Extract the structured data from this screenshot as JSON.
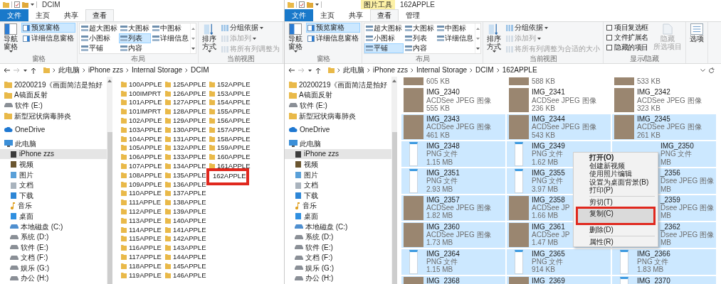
{
  "windows": [
    {
      "title_bar": {
        "title": "DCIM"
      },
      "tabs": [
        {
          "label": "文件",
          "kind": "file",
          "selected": false
        },
        {
          "label": "主页",
          "kind": "tab",
          "selected": false
        },
        {
          "label": "共享",
          "kind": "tab",
          "selected": false
        },
        {
          "label": "查看",
          "kind": "tab",
          "selected": true
        }
      ],
      "ribbon": {
        "groups": [
          {
            "kind": "panes",
            "label": "窗格",
            "large": {
              "label": "导航窗格",
              "dropdown": true
            },
            "buttons": [
              {
                "label": "预览窗格",
                "selected": true
              },
              {
                "label": "详细信息窗格",
                "selected": false
              }
            ]
          },
          {
            "kind": "layout",
            "label": "布局",
            "options": [
              {
                "label": "超大图标",
                "selected": false
              },
              {
                "label": "大图标",
                "selected": false
              },
              {
                "label": "中图标",
                "selected": false
              },
              {
                "label": "小图标",
                "selected": false
              },
              {
                "label": "列表",
                "selected": true
              },
              {
                "label": "详细信息",
                "selected": false
              },
              {
                "label": "平铺",
                "selected": false
              },
              {
                "label": "内容",
                "selected": false
              }
            ]
          },
          {
            "kind": "view",
            "label": "当前视图",
            "large": {
              "label": "排序方式",
              "dropdown": true
            },
            "commands": [
              {
                "label": "分组依据",
                "dropdown": true,
                "disabled": false
              },
              {
                "label": "添加列",
                "dropdown": true,
                "disabled": true
              },
              {
                "label": "将所有列调整为",
                "dropdown": false,
                "disabled": true
              }
            ]
          }
        ]
      },
      "address": {
        "segments": [
          "此电脑",
          "iPhone zzs",
          "Internal Storage",
          "DCIM"
        ]
      },
      "navigation": [
        {
          "label": "20200219《画面简洁是拍好",
          "kind": "folder",
          "selected": false
        },
        {
          "label": "A镜面反射",
          "kind": "folder",
          "selected": false
        },
        {
          "label": "软件 (E:)",
          "kind": "drive",
          "selected": false
        },
        {
          "label": "新型冠状病毒肺炎",
          "kind": "folder",
          "selected": false
        },
        {
          "label": "OneDrive",
          "kind": "cloud",
          "selected": false
        },
        {
          "label": "此电脑",
          "kind": "pc",
          "selected": false,
          "children": [
            {
              "label": "iPhone zzs",
              "kind": "phone",
              "selected": true
            },
            {
              "label": "视频",
              "kind": "video",
              "selected": false
            },
            {
              "label": "图片",
              "kind": "pictures",
              "selected": false
            },
            {
              "label": "文档",
              "kind": "documents",
              "selected": false
            },
            {
              "label": "下载",
              "kind": "downloads",
              "selected": false
            },
            {
              "label": "音乐",
              "kind": "music",
              "selected": false
            },
            {
              "label": "桌面",
              "kind": "desktop",
              "selected": false
            },
            {
              "label": "本地磁盘 (C:)",
              "kind": "system",
              "selected": false
            },
            {
              "label": "系统 (D:)",
              "kind": "drive",
              "selected": false
            },
            {
              "label": "软件 (E:)",
              "kind": "drive",
              "selected": false
            },
            {
              "label": "文档 (F:)",
              "kind": "drive",
              "selected": false
            },
            {
              "label": "娱乐 (G:)",
              "kind": "drive",
              "selected": false
            },
            {
              "label": "办公 (H:)",
              "kind": "drive",
              "selected": false
            }
          ]
        }
      ],
      "content": {
        "kind": "list",
        "folders": [
          {
            "name": "100APPLE",
            "annotated": false
          },
          {
            "name": "100IMPRT",
            "annotated": false
          },
          {
            "name": "101APPLE",
            "annotated": false
          },
          {
            "name": "101IMPRT",
            "annotated": false
          },
          {
            "name": "102APPLE",
            "annotated": false
          },
          {
            "name": "103APPLE",
            "annotated": false
          },
          {
            "name": "104APPLE",
            "annotated": false
          },
          {
            "name": "105APPLE",
            "annotated": false
          },
          {
            "name": "106APPLE",
            "annotated": false
          },
          {
            "name": "107APPLE",
            "annotated": false
          },
          {
            "name": "108APPLE",
            "annotated": false
          },
          {
            "name": "109APPLE",
            "annotated": false
          },
          {
            "name": "110APPLE",
            "annotated": false
          },
          {
            "name": "111APPLE",
            "annotated": false
          },
          {
            "name": "112APPLE",
            "annotated": false
          },
          {
            "name": "113APPLE",
            "annotated": false
          },
          {
            "name": "114APPLE",
            "annotated": false
          },
          {
            "name": "115APPLE",
            "annotated": false
          },
          {
            "name": "116APPLE",
            "annotated": false
          },
          {
            "name": "117APPLE",
            "annotated": false
          },
          {
            "name": "118APPLE",
            "annotated": false
          },
          {
            "name": "119APPLE",
            "annotated": false
          },
          {
            "name": "125APPLE",
            "annotated": false
          },
          {
            "name": "126APPLE",
            "annotated": false
          },
          {
            "name": "127APPLE",
            "annotated": false
          },
          {
            "name": "128APPLE",
            "annotated": false
          },
          {
            "name": "129APPLE",
            "annotated": false
          },
          {
            "name": "130APPLE",
            "annotated": false
          },
          {
            "name": "131APPLE",
            "annotated": false
          },
          {
            "name": "132APPLE",
            "annotated": false
          },
          {
            "name": "133APPLE",
            "annotated": false
          },
          {
            "name": "134APPLE",
            "annotated": false
          },
          {
            "name": "135APPLE",
            "annotated": false
          },
          {
            "name": "136APPLE",
            "annotated": false
          },
          {
            "name": "137APPLE",
            "annotated": false
          },
          {
            "name": "138APPLE",
            "annotated": false
          },
          {
            "name": "139APPLE",
            "annotated": false
          },
          {
            "name": "140APPLE",
            "annotated": false
          },
          {
            "name": "141APPLE",
            "annotated": false
          },
          {
            "name": "142APPLE",
            "annotated": false
          },
          {
            "name": "143APPLE",
            "annotated": false
          },
          {
            "name": "144APPLE",
            "annotated": false
          },
          {
            "name": "145APPLE",
            "annotated": false
          },
          {
            "name": "146APPLE",
            "annotated": false
          },
          {
            "name": "152APPLE",
            "annotated": false
          },
          {
            "name": "153APPLE",
            "annotated": false
          },
          {
            "name": "154APPLE",
            "annotated": false
          },
          {
            "name": "155APPLE",
            "annotated": false
          },
          {
            "name": "156APPLE",
            "annotated": false
          },
          {
            "name": "157APPLE",
            "annotated": false
          },
          {
            "name": "158APPLE",
            "annotated": false
          },
          {
            "name": "159APPLE",
            "annotated": false
          },
          {
            "name": "160APPLE",
            "annotated": false
          },
          {
            "name": "161APPLE",
            "annotated": false
          },
          {
            "name": "162APPLE",
            "annotated": true
          }
        ]
      }
    },
    {
      "title_bar": {
        "context_tab": "图片工具",
        "title": "162APPLE"
      },
      "tabs": [
        {
          "label": "文件",
          "kind": "file",
          "selected": false
        },
        {
          "label": "主页",
          "kind": "tab",
          "selected": false
        },
        {
          "label": "共享",
          "kind": "tab",
          "selected": false
        },
        {
          "label": "查看",
          "kind": "tab",
          "selected": true
        },
        {
          "label": "管理",
          "kind": "tab",
          "selected": false
        }
      ],
      "ribbon": {
        "groups": [
          {
            "kind": "panes",
            "label": "窗格",
            "large": {
              "label": "导航窗格",
              "dropdown": true
            },
            "buttons": [
              {
                "label": "预览窗格",
                "selected": true
              },
              {
                "label": "详细信息窗格",
                "selected": false
              }
            ]
          },
          {
            "kind": "layout",
            "label": "布局",
            "options": [
              {
                "label": "超大图标",
                "selected": false
              },
              {
                "label": "大图标",
                "selected": false
              },
              {
                "label": "中图标",
                "selected": false
              },
              {
                "label": "小图标",
                "selected": false
              },
              {
                "label": "列表",
                "selected": false
              },
              {
                "label": "详细信息",
                "selected": false
              },
              {
                "label": "平铺",
                "selected": true
              },
              {
                "label": "内容",
                "selected": false
              }
            ]
          },
          {
            "kind": "view",
            "label": "当前视图",
            "large": {
              "label": "排序方式",
              "dropdown": true
            },
            "commands": [
              {
                "label": "分组依据",
                "dropdown": true,
                "disabled": false
              },
              {
                "label": "添加列",
                "dropdown": true,
                "disabled": true
              },
              {
                "label": "将所有列调整为合适的大小",
                "dropdown": false,
                "disabled": true
              }
            ]
          },
          {
            "kind": "show",
            "label": "显示/隐藏",
            "checkboxes": [
              {
                "label": "项目复选框",
                "checked": false
              },
              {
                "label": "文件扩展名",
                "checked": false
              },
              {
                "label": "隐藏的项目",
                "checked": false
              }
            ],
            "large": {
              "lines": [
                "隐藏",
                "所选项目"
              ],
              "disabled": true
            }
          },
          {
            "kind": "options",
            "large": {
              "label": "选项"
            }
          }
        ]
      },
      "address": {
        "segments": [
          "此电脑",
          "iPhone zzs",
          "Internal Storage",
          "DCIM",
          "162APPLE"
        ]
      },
      "navigation": [
        {
          "label": "20200219《画面简洁是拍好",
          "kind": "folder",
          "selected": false
        },
        {
          "label": "A镜面反射",
          "kind": "folder",
          "selected": false
        },
        {
          "label": "软件 (E:)",
          "kind": "drive",
          "selected": false
        },
        {
          "label": "新型冠状病毒肺炎",
          "kind": "folder",
          "selected": false
        },
        {
          "label": "OneDrive",
          "kind": "cloud",
          "selected": false
        },
        {
          "label": "此电脑",
          "kind": "pc",
          "selected": false,
          "children": [
            {
              "label": "iPhone zzs",
              "kind": "phone",
              "selected": true
            },
            {
              "label": "视频",
              "kind": "video",
              "selected": false
            },
            {
              "label": "图片",
              "kind": "pictures",
              "selected": false
            },
            {
              "label": "文档",
              "kind": "documents",
              "selected": false
            },
            {
              "label": "下载",
              "kind": "downloads",
              "selected": false
            },
            {
              "label": "音乐",
              "kind": "music",
              "selected": false
            },
            {
              "label": "桌面",
              "kind": "desktop",
              "selected": false
            },
            {
              "label": "本地磁盘 (C:)",
              "kind": "system",
              "selected": false
            },
            {
              "label": "系统 (D:)",
              "kind": "drive",
              "selected": false
            },
            {
              "label": "软件 (E:)",
              "kind": "drive",
              "selected": false
            },
            {
              "label": "文档 (F:)",
              "kind": "drive",
              "selected": false
            },
            {
              "label": "娱乐 (G:)",
              "kind": "drive",
              "selected": false
            },
            {
              "label": "办公 (H:)",
              "kind": "drive",
              "selected": false
            }
          ]
        }
      ],
      "content": {
        "kind": "tiles",
        "tiles": [
          {
            "size": "605 KB",
            "kind": "photo",
            "selected": false,
            "covered": false
          },
          {
            "size": "588 KB",
            "kind": "photo",
            "selected": false,
            "covered": false
          },
          {
            "size": "533 KB",
            "kind": "photo",
            "selected": false,
            "covered": false
          },
          {
            "name": "IMG_2340",
            "type": "ACDSee JPEG 图像",
            "size": "555 KB",
            "kind": "photo",
            "selected": false,
            "covered": false
          },
          {
            "name": "IMG_2341",
            "type": "ACDSee JPEG 图像",
            "size": "236 KB",
            "kind": "photo",
            "selected": false,
            "covered": false
          },
          {
            "name": "IMG_2342",
            "type": "ACDSee JPEG 图像",
            "size": "323 KB",
            "kind": "photo",
            "selected": false,
            "covered": false
          },
          {
            "name": "IMG_2343",
            "type": "ACDSee JPEG 图像",
            "size": "461 KB",
            "kind": "photo",
            "selected": true,
            "covered": false
          },
          {
            "name": "IMG_2344",
            "type": "ACDSee JPEG 图像",
            "size": "543 KB",
            "kind": "photo",
            "selected": true,
            "covered": false
          },
          {
            "name": "IMG_2345",
            "type": "ACDSee JPEG 图像",
            "size": "261 KB",
            "kind": "photo",
            "selected": true,
            "covered": false
          },
          {
            "name": "IMG_2348",
            "type": "PNG 文件",
            "size": "1.15 MB",
            "kind": "screenshot",
            "selected": true,
            "covered": false
          },
          {
            "name": "IMG_2349",
            "type": "PNG 文件",
            "size": "1.62 MB",
            "kind": "screenshot",
            "selected": true,
            "covered": false
          },
          {
            "name": "IMG_2350",
            "type": "PNG 文件",
            "size": "MB",
            "selected": true,
            "covered": true
          },
          {
            "name": "IMG_2351",
            "type": "PNG 文件",
            "size": "2.93 MB",
            "kind": "screenshot",
            "selected": true,
            "covered": false
          },
          {
            "name": "IMG_2355",
            "type": "PNG 文件",
            "size": "3.97 MB",
            "kind": "screenshot",
            "selected": true,
            "covered": false
          },
          {
            "name": "_2356",
            "type": "Dsee JPEG 图像",
            "size": "MB",
            "selected": true,
            "covered": true
          },
          {
            "name": "IMG_2357",
            "type": "ACDSee JPEG 图像",
            "size": "1.82 MB",
            "kind": "photo",
            "selected": true,
            "covered": false
          },
          {
            "name": "IMG_2358",
            "type": "ACDSee JP",
            "size": "1.66 MB",
            "kind": "photo",
            "selected": true,
            "covered": false
          },
          {
            "name": "_2359",
            "type": "Dsee JPEG 图像",
            "size": "MB",
            "selected": true,
            "covered": true
          },
          {
            "name": "IMG_2360",
            "type": "ACDSee JPEG 图像",
            "size": "1.73 MB",
            "kind": "photo",
            "selected": true,
            "covered": false
          },
          {
            "name": "IMG_2361",
            "type": "ACDSee JP",
            "size": "1.47 MB",
            "kind": "photo",
            "selected": true,
            "covered": false
          },
          {
            "name": "_2362",
            "type": "Dsee JPEG 图像",
            "size": "MB",
            "selected": true,
            "covered": true
          },
          {
            "name": "IMG_2364",
            "type": "PNG 文件",
            "size": "1.15 MB",
            "kind": "screenshot",
            "selected": true,
            "covered": false
          },
          {
            "name": "IMG_2365",
            "type": "PNG 文件",
            "size": "914 KB",
            "kind": "screenshot",
            "selected": true,
            "covered": false
          },
          {
            "name": "IMG_2366",
            "type": "PNG 文件",
            "size": "1.83 MB",
            "kind": "screenshot",
            "selected": true,
            "covered": false
          },
          {
            "name": "IMG_2368",
            "kind": "photo",
            "selected": true,
            "covered": false
          },
          {
            "name": "IMG_2369",
            "kind": "photo",
            "selected": true,
            "covered": false
          },
          {
            "name": "IMG_2370",
            "kind": "screenshot",
            "selected": true,
            "covered": false
          }
        ]
      },
      "context_menu": {
        "items": [
          {
            "label": "打开(O)",
            "kind": "default",
            "selected": false,
            "annotated": false
          },
          {
            "label": "创建新视频",
            "kind": "item",
            "selected": false,
            "annotated": false
          },
          {
            "label": "使用照片编辑",
            "kind": "item",
            "selected": false,
            "annotated": false
          },
          {
            "label": "设置为桌面背景(B)",
            "kind": "item",
            "selected": false,
            "annotated": false
          },
          {
            "label": "打印(P)",
            "kind": "item",
            "selected": false,
            "annotated": false
          },
          {
            "kind": "separator"
          },
          {
            "label": "剪切(T)",
            "kind": "item",
            "selected": false,
            "annotated": false
          },
          {
            "label": "复制(C)",
            "kind": "item",
            "selected": true,
            "annotated": true
          },
          {
            "label": "删除(D)",
            "kind": "item",
            "selected": false,
            "annotated": false
          },
          {
            "kind": "separator"
          },
          {
            "label": "属性(R)",
            "kind": "item",
            "selected": false,
            "annotated": false
          }
        ]
      }
    }
  ]
}
